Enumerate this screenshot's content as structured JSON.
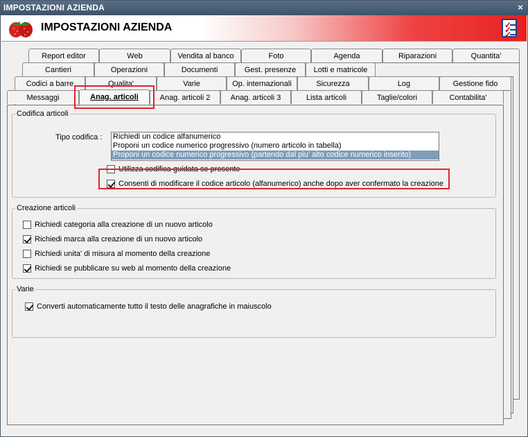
{
  "window": {
    "title": "IMPOSTAZIONI AZIENDA",
    "close_glyph": "×"
  },
  "header": {
    "title": "IMPOSTAZIONI AZIENDA",
    "logo_icon": "strawberry-icon",
    "settings_icon": "checklist-icon"
  },
  "tabs": {
    "row1": [
      "Report editor",
      "Web",
      "Vendita al banco",
      "Foto",
      "Agenda",
      "Riparazioni",
      "Quantita'"
    ],
    "row2": [
      "Cantieri",
      "Operazioni",
      "Documenti",
      "Gest. presenze",
      "Lotti e matricole"
    ],
    "row3": [
      "Codici a barre",
      "Qualita'",
      "Varie",
      "Op. internazionali",
      "Sicurezza",
      "Log",
      "Gestione fido"
    ],
    "row4": [
      "Messaggi",
      "Anag. articoli",
      "Anag. articoli 2",
      "Anag. articoli 3",
      "Lista articoli",
      "Taglie/colori",
      "Contabilita'"
    ],
    "active": "Anag. articoli"
  },
  "codifica": {
    "legend": "Codifica articoli",
    "tipo_label": "Tipo codifica :",
    "options": [
      "Richiedi un codice alfanumerico",
      "Proponi un codice numerico progressivo (numero articolo in tabella)",
      "Proponi un codice numerico progressivo (partendo dal piu' alto codice numerico inserito)"
    ],
    "selected_index": 2,
    "guidata": {
      "label": "Utilizza codifica guidata se presente",
      "checked": false
    },
    "modifica": {
      "label": "Consenti di modificare il codice articolo (alfanumerico) anche dopo aver confermato la creazione",
      "checked": true
    }
  },
  "creazione": {
    "legend": "Creazione articoli",
    "items": [
      {
        "label": "Richiedi categoria alla creazione di un nuovo articolo",
        "checked": false
      },
      {
        "label": "Richiedi marca alla creazione di un nuovo articolo",
        "checked": true
      },
      {
        "label": "Richiedi unita' di misura al momento della creazione",
        "checked": false
      },
      {
        "label": "Richiedi se pubblicare su web al momento della creazione",
        "checked": true
      }
    ]
  },
  "varie": {
    "legend": "Varie",
    "items": [
      {
        "label": "Converti automaticamente tutto il testo delle anagrafiche in maiuscolo",
        "checked": true
      }
    ]
  },
  "colors": {
    "highlight": "#e0242c",
    "selection": "#7f9db9",
    "title_bar": "#4a5f77"
  }
}
